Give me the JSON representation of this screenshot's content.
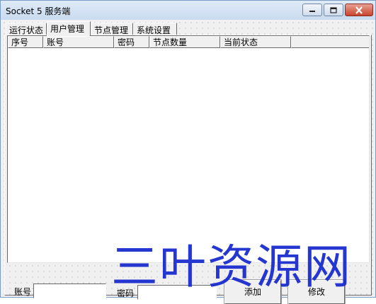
{
  "window": {
    "title": "Socket 5 服务端",
    "controls": [
      "minimize-icon",
      "maximize-icon",
      "close-icon"
    ]
  },
  "tabs": [
    {
      "label": "运行状态",
      "active": false
    },
    {
      "label": "用户管理",
      "active": true
    },
    {
      "label": "节点管理",
      "active": false
    },
    {
      "label": "系统设置",
      "active": false
    }
  ],
  "user_list": {
    "columns": [
      "序号",
      "账号",
      "密码",
      "节点数量",
      "当前状态"
    ],
    "rows": []
  },
  "form": {
    "account_label": "账号",
    "account_value": "",
    "password_label": "密码",
    "password_value": "",
    "add_label": "添加",
    "edit_label": "修改"
  },
  "watermark": "三叶资源网",
  "colors": {
    "titlebar": "#c9dbef",
    "close_button": "#c7432c",
    "watermark": "#1b2ccf"
  }
}
